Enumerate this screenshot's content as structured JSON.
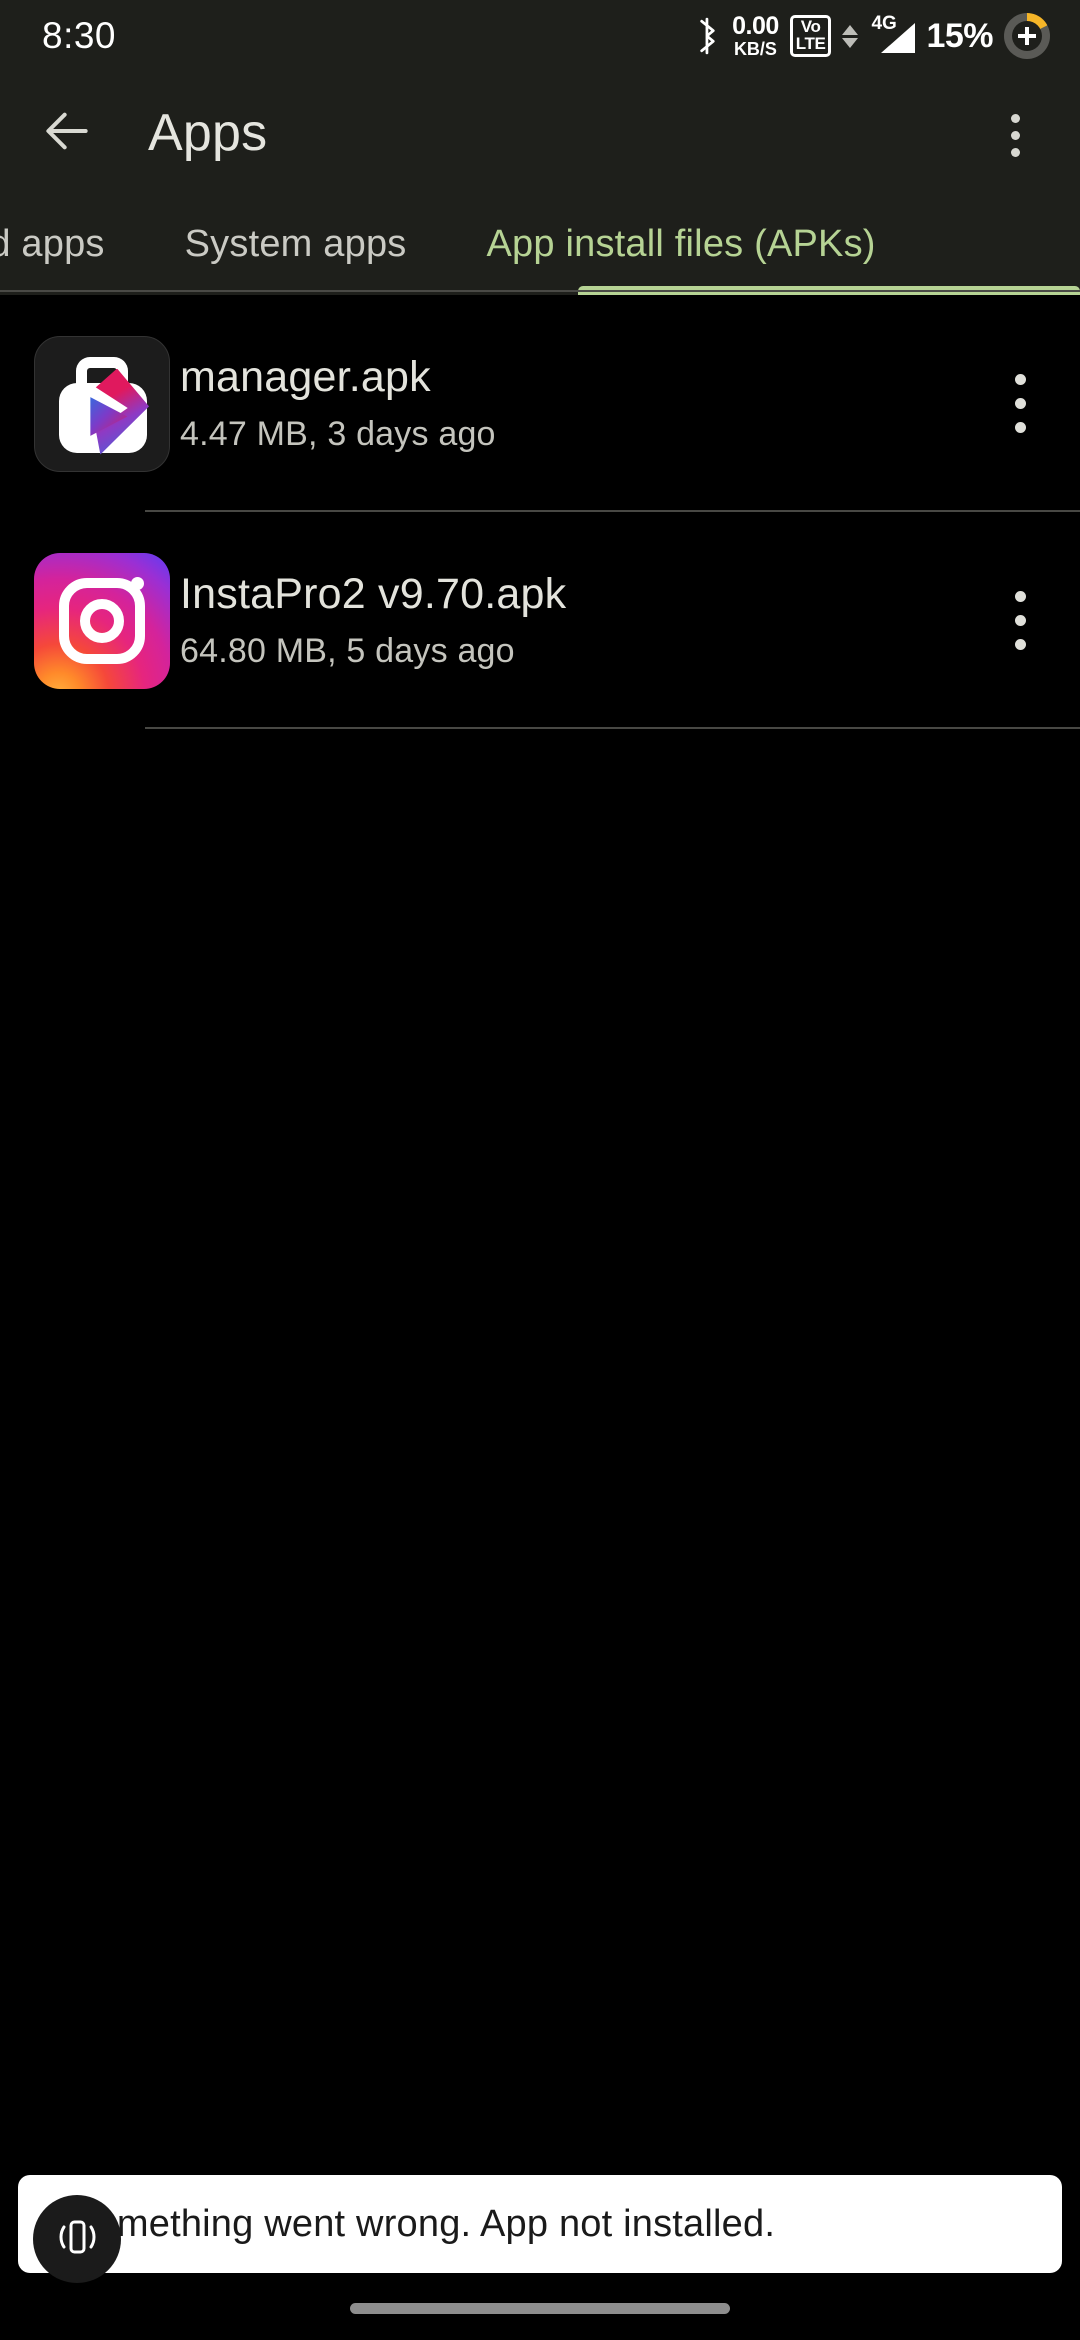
{
  "status_bar": {
    "clock": "8:30",
    "bluetooth_icon": "bluetooth-icon",
    "net_speed_value": "0.00",
    "net_speed_unit": "KB/S",
    "volte_line1": "Vo",
    "volte_line2": "LTE",
    "network_type": "4G",
    "battery_percent": "15%",
    "battery_charging_icon": "plus-icon",
    "accent_battery": "#f5b528"
  },
  "toolbar": {
    "back_icon": "arrow-left-icon",
    "title": "Apps",
    "overflow_icon": "more-vertical-icon"
  },
  "tabs": {
    "items": [
      {
        "label": "ed apps",
        "active": false
      },
      {
        "label": "System apps",
        "active": false
      },
      {
        "label": "App install files (APKs)",
        "active": true
      }
    ],
    "active_color": "#b6d394",
    "inactive_color": "#cacac4"
  },
  "list": {
    "items": [
      {
        "icon": "apk-manager-icon",
        "title": "manager.apk",
        "subtitle": "4.47 MB, 3 days ago",
        "menu_icon": "more-vertical-icon"
      },
      {
        "icon": "instagram-icon",
        "title": "InstaPro2 v9.70.apk",
        "subtitle": "64.80 MB, 5 days ago",
        "menu_icon": "more-vertical-icon"
      }
    ]
  },
  "toast": {
    "message": "Something went wrong. App not installed.",
    "bubble_icon": "phone-vibrate-icon",
    "background": "#ffffff",
    "text_color": "#1a1a1a"
  },
  "navigation_bar": {
    "gesture_pill": "home-gesture-pill"
  }
}
